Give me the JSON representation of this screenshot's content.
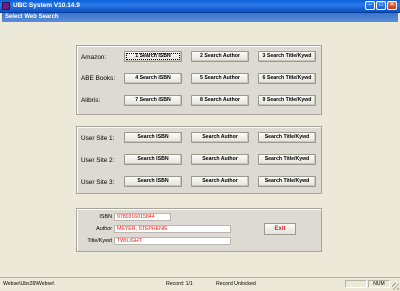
{
  "window": {
    "title": "UBC System V10.14.9",
    "controls": {
      "minimize": "–",
      "maximize": "□",
      "close": "✕"
    }
  },
  "form": {
    "title": "Select Web Search"
  },
  "search_groups": [
    {
      "label": "Amazon:",
      "buttons": [
        "1 Search ISBN",
        "2 Search Author",
        "3 Search Title/Kywd"
      ]
    },
    {
      "label": "ABE Books:",
      "buttons": [
        "4 Search ISBN",
        "5 Search Author",
        "6 Search Title/Kywd"
      ]
    },
    {
      "label": "Alibris:",
      "buttons": [
        "7 Search ISBN",
        "8 Search Author",
        "9 Search Title/Kywd"
      ]
    }
  ],
  "user_sites": [
    {
      "label": "User Site 1:",
      "buttons": [
        "Search ISBN",
        "Search Author",
        "Search Title/Kywd"
      ]
    },
    {
      "label": "User Site 2:",
      "buttons": [
        "Search ISBN",
        "Search Author",
        "Search Title/Kywd"
      ]
    },
    {
      "label": "User Site 3:",
      "buttons": [
        "Search ISBN",
        "Search Author",
        "Search Title/Kywd"
      ]
    }
  ],
  "fields": {
    "isbn": {
      "label": "ISBN",
      "value": "9780316015844"
    },
    "author": {
      "label": "Author",
      "value": "MEYER, STEPHENIE"
    },
    "title_kywd": {
      "label": "Title/Kywd",
      "value": "TWILIGHT"
    }
  },
  "exit_button": "Exit",
  "status_bar": {
    "left": "Webse\\Ubs39\\Webse\\",
    "record": "Record: 1/1",
    "lock": "Record Unlocked",
    "num": "NUM"
  },
  "colors": {
    "title_bar": "#0a5fd8",
    "form_header": "#3b73c9",
    "field_text": "#e0201a",
    "exit_text": "#d4201a"
  },
  "icons": [
    "app-icon",
    "minimize-icon",
    "maximize-icon",
    "close-icon",
    "resize-grip-icon"
  ]
}
